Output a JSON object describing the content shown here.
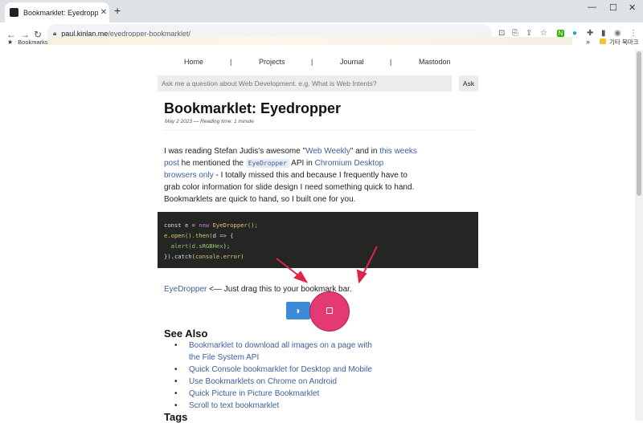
{
  "browser": {
    "tab_title": "Bookmarklet: Eyedropper",
    "url_host": "paul.kinlan.me",
    "url_path": "/eyedropper-bookmarklet/",
    "bookmarks_label": "Bookmarks",
    "other_bookmarks": "기타 북마크"
  },
  "nav": {
    "home": "Home",
    "projects": "Projects",
    "journal": "Journal",
    "mastodon": "Mastodon",
    "separator": "|"
  },
  "search": {
    "placeholder": "Ask me a question about Web Development. e.g. What is Web Intents?",
    "button": "Ask"
  },
  "post": {
    "title": "Bookmarklet: Eyedropper",
    "meta": "May 2 2023 — Reading time: 1 minute",
    "p1_a": "I was reading Stefan Judis's awesome \"",
    "p1_link1": "Web Weekly",
    "p1_b": "\" and in ",
    "p1_link2a": "this weeks",
    "p1_link2b": "post",
    "p1_c": " he mentioned the ",
    "p1_code": "EyeDropper",
    "p1_d": " API in ",
    "p1_link3a": "Chromium Desktop",
    "p1_link3b": "browsers only",
    "p1_e": " - I totally missed this and because I frequently have to",
    "p1_f": "grab color information for slide design I need something quick to hand.",
    "p1_g": "Bookmarklets are quick to hand, so I built one for you.",
    "eyedropper_link": "EyeDropper",
    "eyedropper_text": " <— Just drag this to your bookmark bar.",
    "see_also": "See Also",
    "related": [
      "Bookmarklet to download all images on a page with",
      "the File System API",
      "Quick Console bookmarklet for Desktop and Mobile",
      "Use Bookmarklets on Chrome on Android",
      "Quick Picture in Picture Bookmarklet",
      "Scroll to text bookmarklet"
    ],
    "tags": "Tags"
  },
  "code": {
    "l1_a": "const e = ",
    "l1_b": "new",
    "l1_c": " EyeDropper();",
    "l2_a": "e.open().then(",
    "l2_b": "d => {",
    "l3_a": "  alert(",
    "l3_b": "d.sRGBHex",
    "l3_c": ");",
    "l4_a": "}).catch(",
    "l4_b": "console.error",
    "l4_c": ")"
  },
  "colors": {
    "accent": "#e33a73",
    "link": "#3b5fa0",
    "code_bg": "#232622",
    "rss": "#3c8ad8"
  }
}
